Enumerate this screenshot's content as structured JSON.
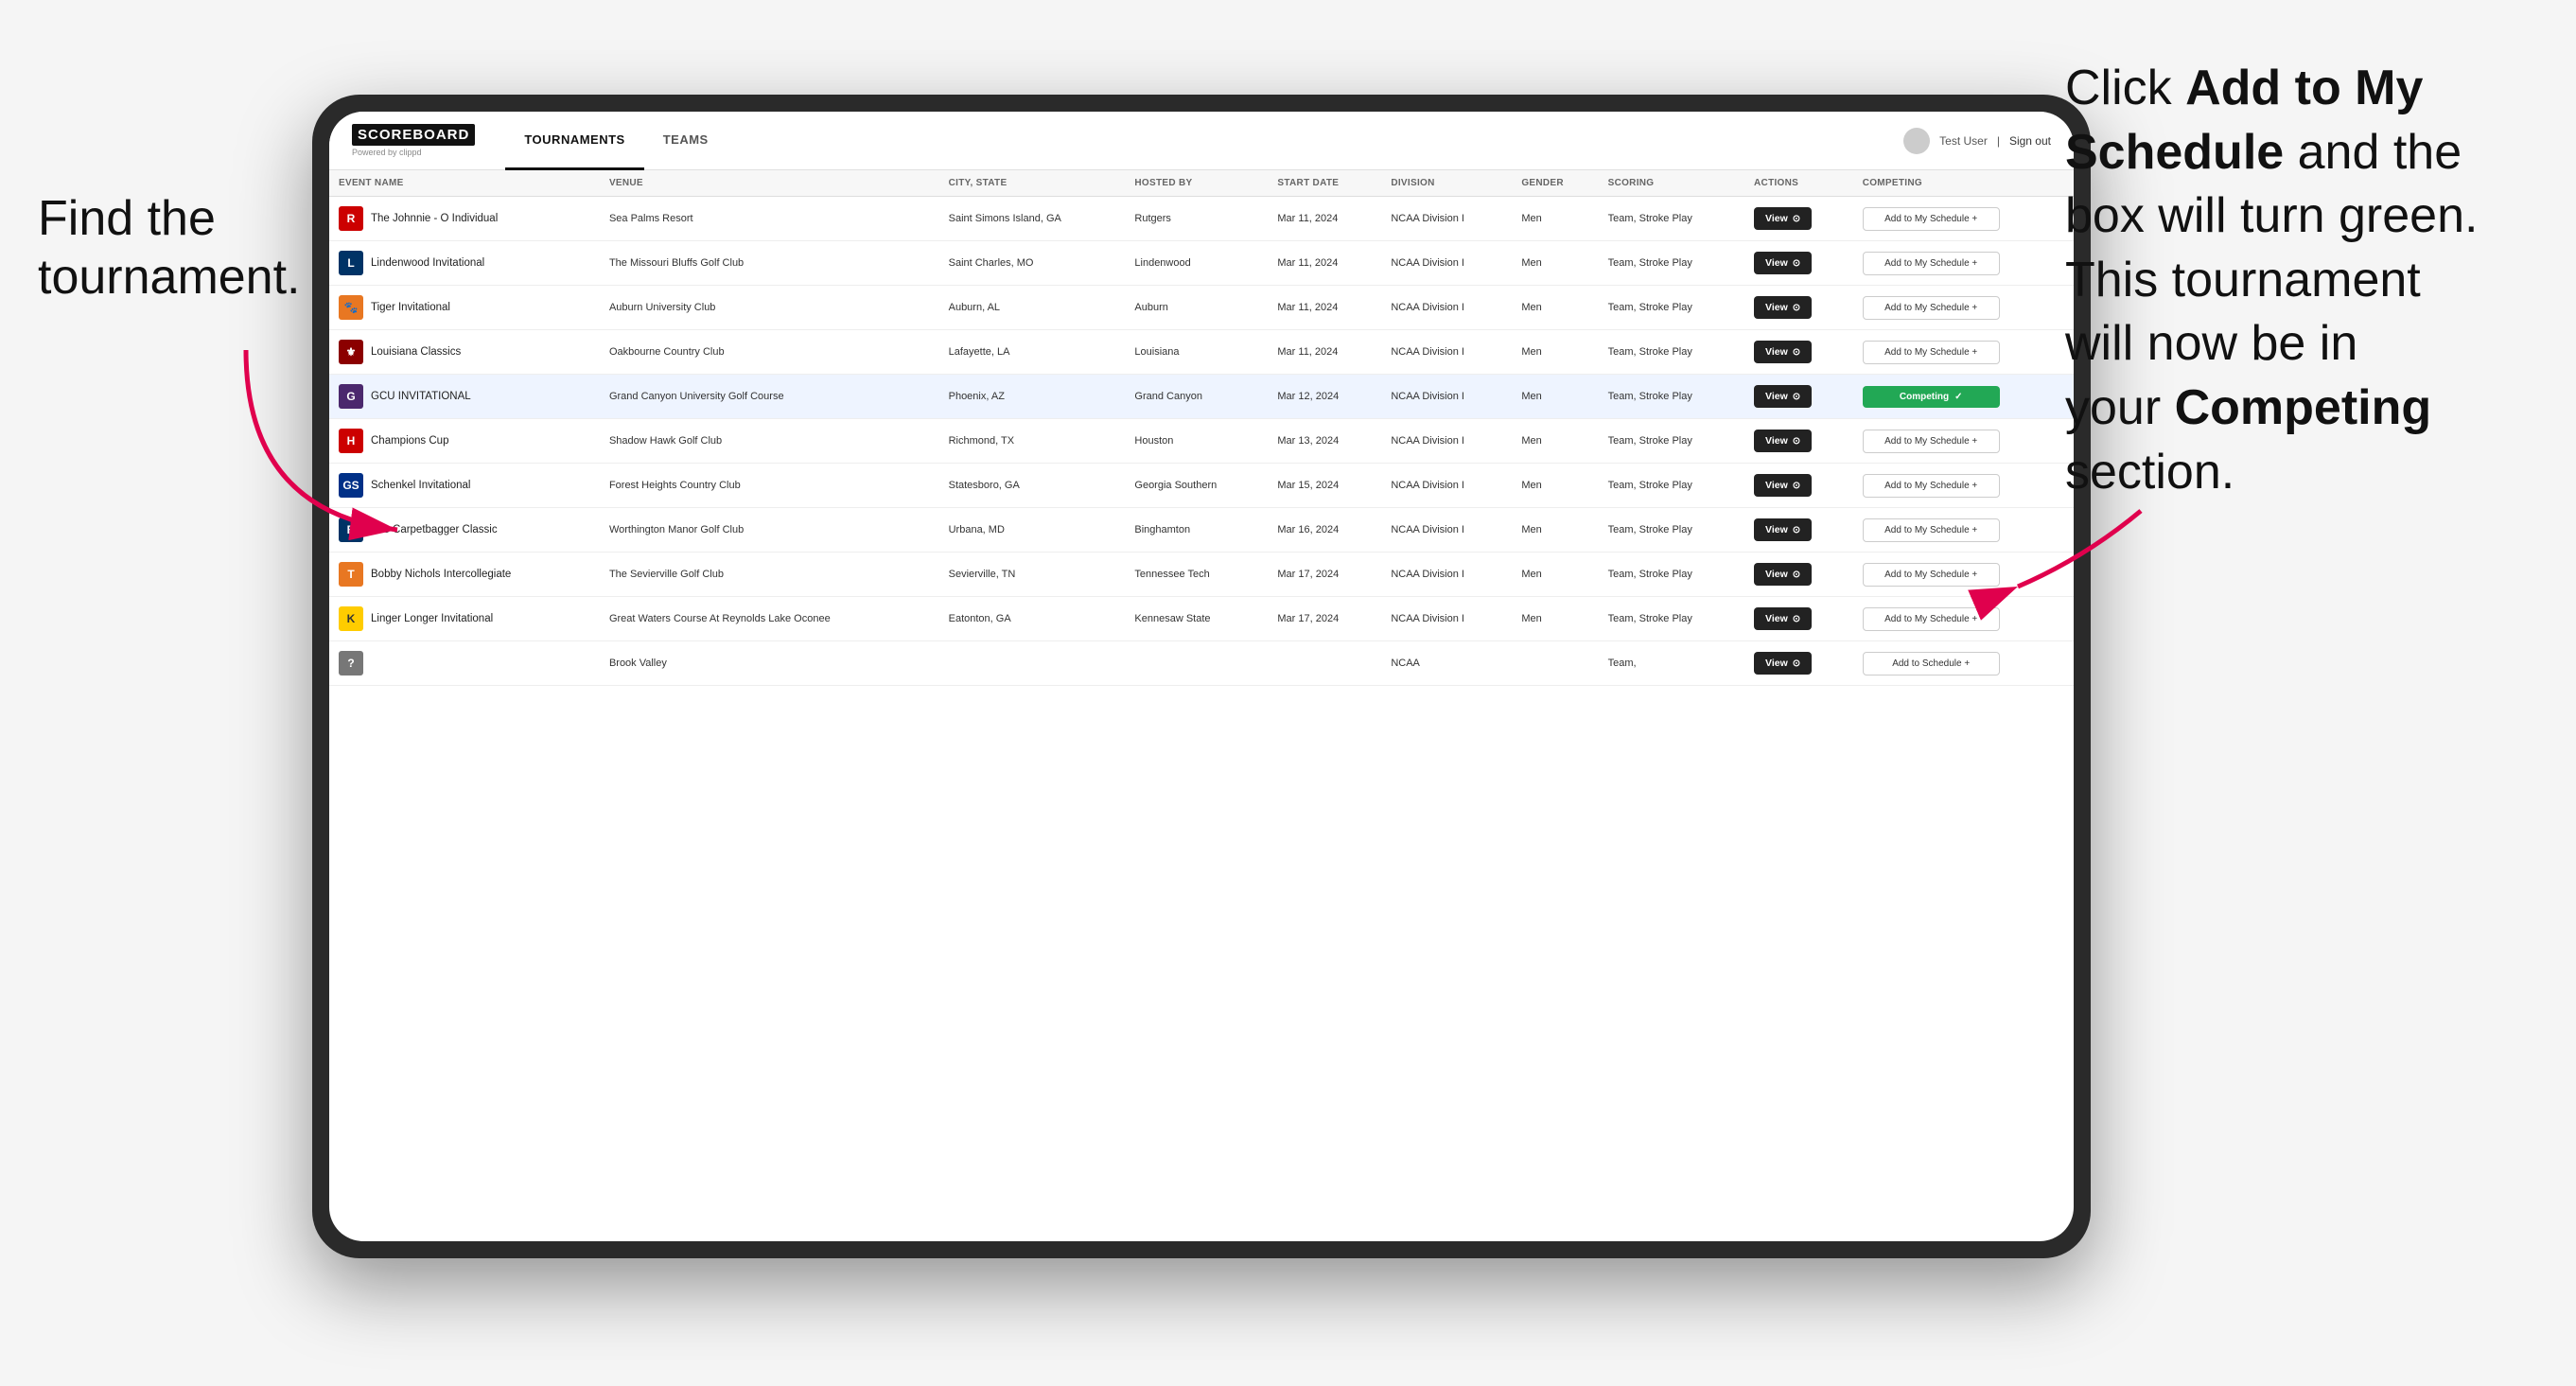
{
  "annotations": {
    "left": "Find the\ntournament.",
    "right_parts": [
      {
        "text": "Click ",
        "bold": false
      },
      {
        "text": "Add to My\nSchedule",
        "bold": true
      },
      {
        "text": " and the\nbox will turn green.\nThis tournament\nwill now be in\nyour ",
        "bold": false
      },
      {
        "text": "Competing",
        "bold": true
      },
      {
        "text": "\nsection.",
        "bold": false
      }
    ]
  },
  "nav": {
    "logo": "SCOREBOARD",
    "logo_sub": "Powered by clippd",
    "tabs": [
      "TOURNAMENTS",
      "TEAMS"
    ],
    "active_tab": "TOURNAMENTS",
    "user_label": "Test User",
    "signout_label": "Sign out"
  },
  "table": {
    "headers": [
      "EVENT NAME",
      "VENUE",
      "CITY, STATE",
      "HOSTED BY",
      "START DATE",
      "DIVISION",
      "GENDER",
      "SCORING",
      "ACTIONS",
      "COMPETING"
    ],
    "rows": [
      {
        "logo_color": "#cc0000",
        "logo_text": "R",
        "event": "The Johnnie - O Individual",
        "venue": "Sea Palms Resort",
        "city": "Saint Simons Island, GA",
        "hosted": "Rutgers",
        "date": "Mar 11, 2024",
        "division": "NCAA Division I",
        "gender": "Men",
        "scoring": "Team, Stroke Play",
        "view_label": "View",
        "add_label": "Add to My Schedule +",
        "competing": false,
        "highlighted": false
      },
      {
        "logo_color": "#1a6b3c",
        "logo_text": "L",
        "event": "Lindenwood Invitational",
        "venue": "The Missouri Bluffs Golf Club",
        "city": "Saint Charles, MO",
        "hosted": "Lindenwood",
        "date": "Mar 11, 2024",
        "division": "NCAA Division I",
        "gender": "Men",
        "scoring": "Team, Stroke Play",
        "view_label": "View",
        "add_label": "Add to My Schedule +",
        "competing": false,
        "highlighted": false
      },
      {
        "logo_color": "#ff6600",
        "logo_text": "🐯",
        "event": "Tiger Invitational",
        "venue": "Auburn University Club",
        "city": "Auburn, AL",
        "hosted": "Auburn",
        "date": "Mar 11, 2024",
        "division": "NCAA Division I",
        "gender": "Men",
        "scoring": "Team, Stroke Play",
        "view_label": "View",
        "add_label": "Add to My Schedule +",
        "competing": false,
        "highlighted": false
      },
      {
        "logo_color": "#8b0000",
        "logo_text": "⚜",
        "event": "Louisiana Classics",
        "venue": "Oakbourne Country Club",
        "city": "Lafayette, LA",
        "hosted": "Louisiana",
        "date": "Mar 11, 2024",
        "division": "NCAA Division I",
        "gender": "Men",
        "scoring": "Team, Stroke Play",
        "view_label": "View",
        "add_label": "Add to My Schedule +",
        "competing": false,
        "highlighted": false
      },
      {
        "logo_color": "#663399",
        "logo_text": "GCU",
        "event": "GCU INVITATIONAL",
        "venue": "Grand Canyon University Golf Course",
        "city": "Phoenix, AZ",
        "hosted": "Grand Canyon",
        "date": "Mar 12, 2024",
        "division": "NCAA Division I",
        "gender": "Men",
        "scoring": "Team, Stroke Play",
        "view_label": "View",
        "add_label": "Competing ✓",
        "competing": true,
        "highlighted": true
      },
      {
        "logo_color": "#cc0000",
        "logo_text": "H",
        "event": "Champions Cup",
        "venue": "Shadow Hawk Golf Club",
        "city": "Richmond, TX",
        "hosted": "Houston",
        "date": "Mar 13, 2024",
        "division": "NCAA Division I",
        "gender": "Men",
        "scoring": "Team, Stroke Play",
        "view_label": "View",
        "add_label": "Add to My Schedule +",
        "competing": false,
        "highlighted": false
      },
      {
        "logo_color": "#004080",
        "logo_text": "GS",
        "event": "Schenkel Invitational",
        "venue": "Forest Heights Country Club",
        "city": "Statesboro, GA",
        "hosted": "Georgia Southern",
        "date": "Mar 15, 2024",
        "division": "NCAA Division I",
        "gender": "Men",
        "scoring": "Team, Stroke Play",
        "view_label": "View",
        "add_label": "Add to My Schedule +",
        "competing": false,
        "highlighted": false
      },
      {
        "logo_color": "#003366",
        "logo_text": "B",
        "event": "The Carpetbagger Classic",
        "venue": "Worthington Manor Golf Club",
        "city": "Urbana, MD",
        "hosted": "Binghamton",
        "date": "Mar 16, 2024",
        "division": "NCAA Division I",
        "gender": "Men",
        "scoring": "Team, Stroke Play",
        "view_label": "View",
        "add_label": "Add to My Schedule +",
        "competing": false,
        "highlighted": false
      },
      {
        "logo_color": "#ff6600",
        "logo_text": "TT",
        "event": "Bobby Nichols Intercollegiate",
        "venue": "The Sevierville Golf Club",
        "city": "Sevierville, TN",
        "hosted": "Tennessee Tech",
        "date": "Mar 17, 2024",
        "division": "NCAA Division I",
        "gender": "Men",
        "scoring": "Team, Stroke Play",
        "view_label": "View",
        "add_label": "Add to My Schedule +",
        "competing": false,
        "highlighted": false
      },
      {
        "logo_color": "#ffcc00",
        "logo_text": "KSU",
        "event": "Linger Longer Invitational",
        "venue": "Great Waters Course At Reynolds Lake Oconee",
        "city": "Eatonton, GA",
        "hosted": "Kennesaw State",
        "date": "Mar 17, 2024",
        "division": "NCAA Division I",
        "gender": "Men",
        "scoring": "Team, Stroke Play",
        "view_label": "View",
        "add_label": "Add to My Schedule +",
        "competing": false,
        "highlighted": false
      },
      {
        "logo_color": "#006600",
        "logo_text": "X",
        "event": "",
        "venue": "Brook Valley",
        "city": "",
        "hosted": "",
        "date": "",
        "division": "NCAA",
        "gender": "",
        "scoring": "Team,",
        "view_label": "View",
        "add_label": "Add to Schedule +",
        "competing": false,
        "highlighted": false
      }
    ]
  }
}
